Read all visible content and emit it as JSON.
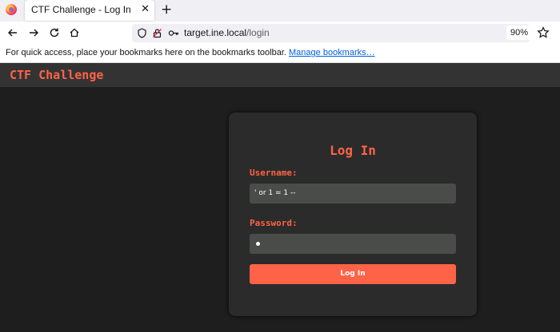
{
  "browser": {
    "tab_title": "CTF Challenge - Log In",
    "tab_close": "✕",
    "new_tab": "+",
    "url_host": "target.ine.local",
    "url_path": "/login",
    "zoom": "90%",
    "bookmarks_text": "For quick access, place your bookmarks here on the bookmarks toolbar.",
    "bookmarks_link": "Manage bookmarks…"
  },
  "site": {
    "title": "CTF Challenge"
  },
  "login": {
    "heading": "Log In",
    "username_label": "Username:",
    "username_value": "' or 1 = 1 --",
    "password_label": "Password:",
    "submit_label": "Log In"
  },
  "colors": {
    "accent": "#ff6347",
    "header_bg": "#333333",
    "page_bg": "#1e1e1e",
    "card_bg": "#2b2b2b",
    "input_bg": "#4a4c4a"
  }
}
